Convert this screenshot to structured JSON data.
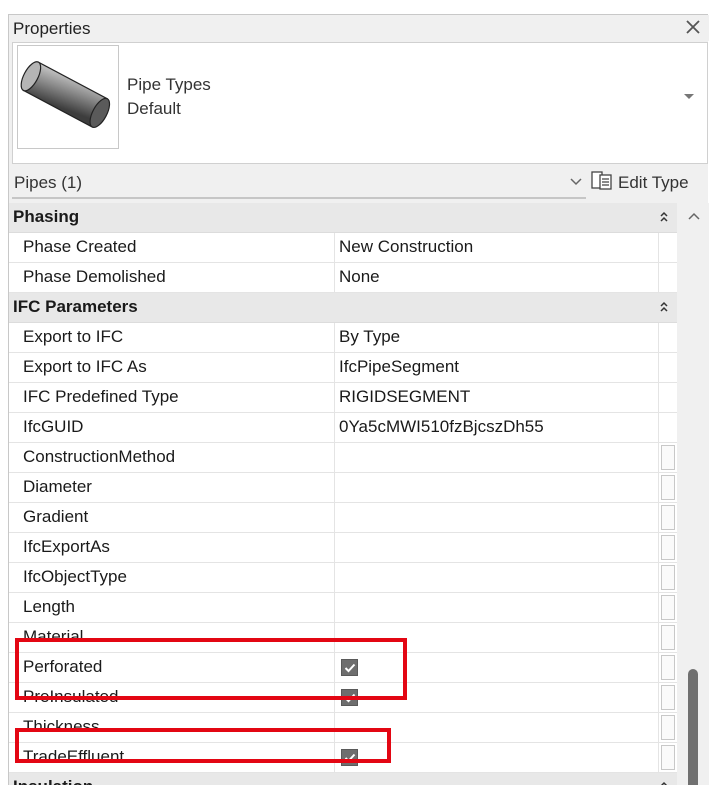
{
  "panel": {
    "title": "Properties"
  },
  "type_selector": {
    "family": "Pipe Types",
    "type": "Default",
    "thumbnail_icon": "pipe-cylinder-icon"
  },
  "filter": {
    "label": "Pipes (1)",
    "edit_type_label": "Edit Type"
  },
  "groups": {
    "phasing": {
      "name": "Phasing",
      "rows": [
        {
          "name": "Phase Created",
          "value": "New Construction"
        },
        {
          "name": "Phase Demolished",
          "value": "None"
        }
      ]
    },
    "ifc": {
      "name": "IFC Parameters",
      "rows": [
        {
          "name": "Export to IFC",
          "value": "By Type"
        },
        {
          "name": "Export to IFC As",
          "value": "IfcPipeSegment"
        },
        {
          "name": "IFC Predefined Type",
          "value": "RIGIDSEGMENT"
        },
        {
          "name": "IfcGUID",
          "value": "0Ya5cMWI510fzBjcszDh55"
        },
        {
          "name": "ConstructionMethod",
          "value": ""
        },
        {
          "name": "Diameter",
          "value": ""
        },
        {
          "name": "Gradient",
          "value": ""
        },
        {
          "name": "IfcExportAs",
          "value": ""
        },
        {
          "name": "IfcObjectType",
          "value": ""
        },
        {
          "name": "Length",
          "value": ""
        },
        {
          "name": "Material",
          "value": ""
        },
        {
          "name": "Perforated",
          "checked": true
        },
        {
          "name": "PreInsulated",
          "checked": true
        },
        {
          "name": "Thickness",
          "value": ""
        },
        {
          "name": "TradeEffluent",
          "checked": true
        }
      ]
    },
    "insulation": {
      "name": "Insulation"
    }
  },
  "colors": {
    "highlight": "#e30613",
    "group_bg": "#e8e8e8",
    "checkbox": "#6e6e6e"
  }
}
